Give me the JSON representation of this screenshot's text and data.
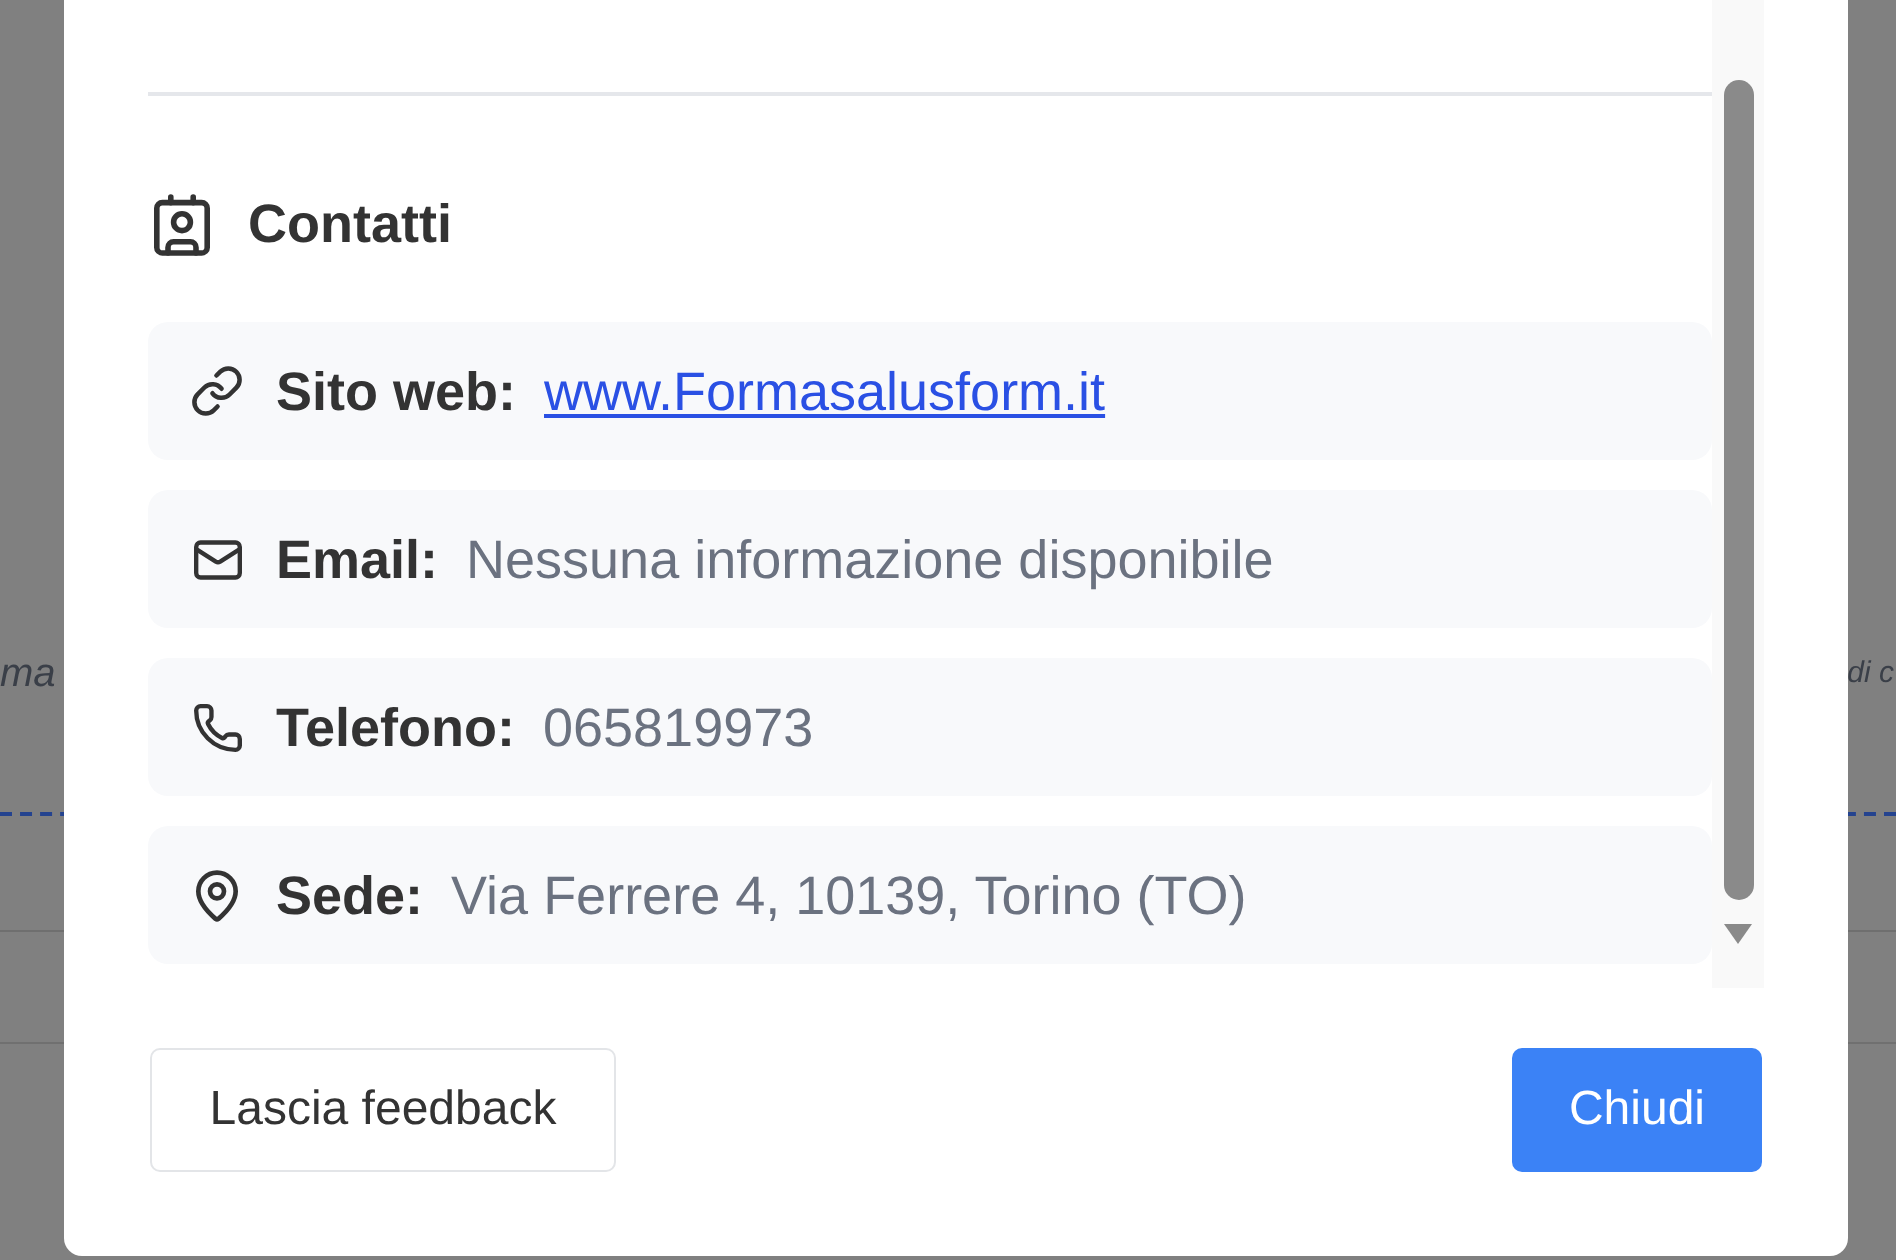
{
  "background": {
    "left_text": "ma",
    "right_text": "di c"
  },
  "dialog": {
    "section": {
      "title": "Contatti"
    },
    "contacts": [
      {
        "kind": "link",
        "label": "Sito web:",
        "value": "www.Formasalusform.it"
      },
      {
        "kind": "email",
        "label": "Email:",
        "value": "Nessuna informazione disponibile"
      },
      {
        "kind": "phone",
        "label": "Telefono:",
        "value": "065819973"
      },
      {
        "kind": "location",
        "label": "Sede:",
        "value": "Via Ferrere 4, 10139, Torino (TO)"
      }
    ],
    "buttons": [
      {
        "kind": "secondary",
        "label": "Lascia feedback"
      },
      {
        "kind": "primary",
        "label": "Chiudi"
      }
    ]
  }
}
